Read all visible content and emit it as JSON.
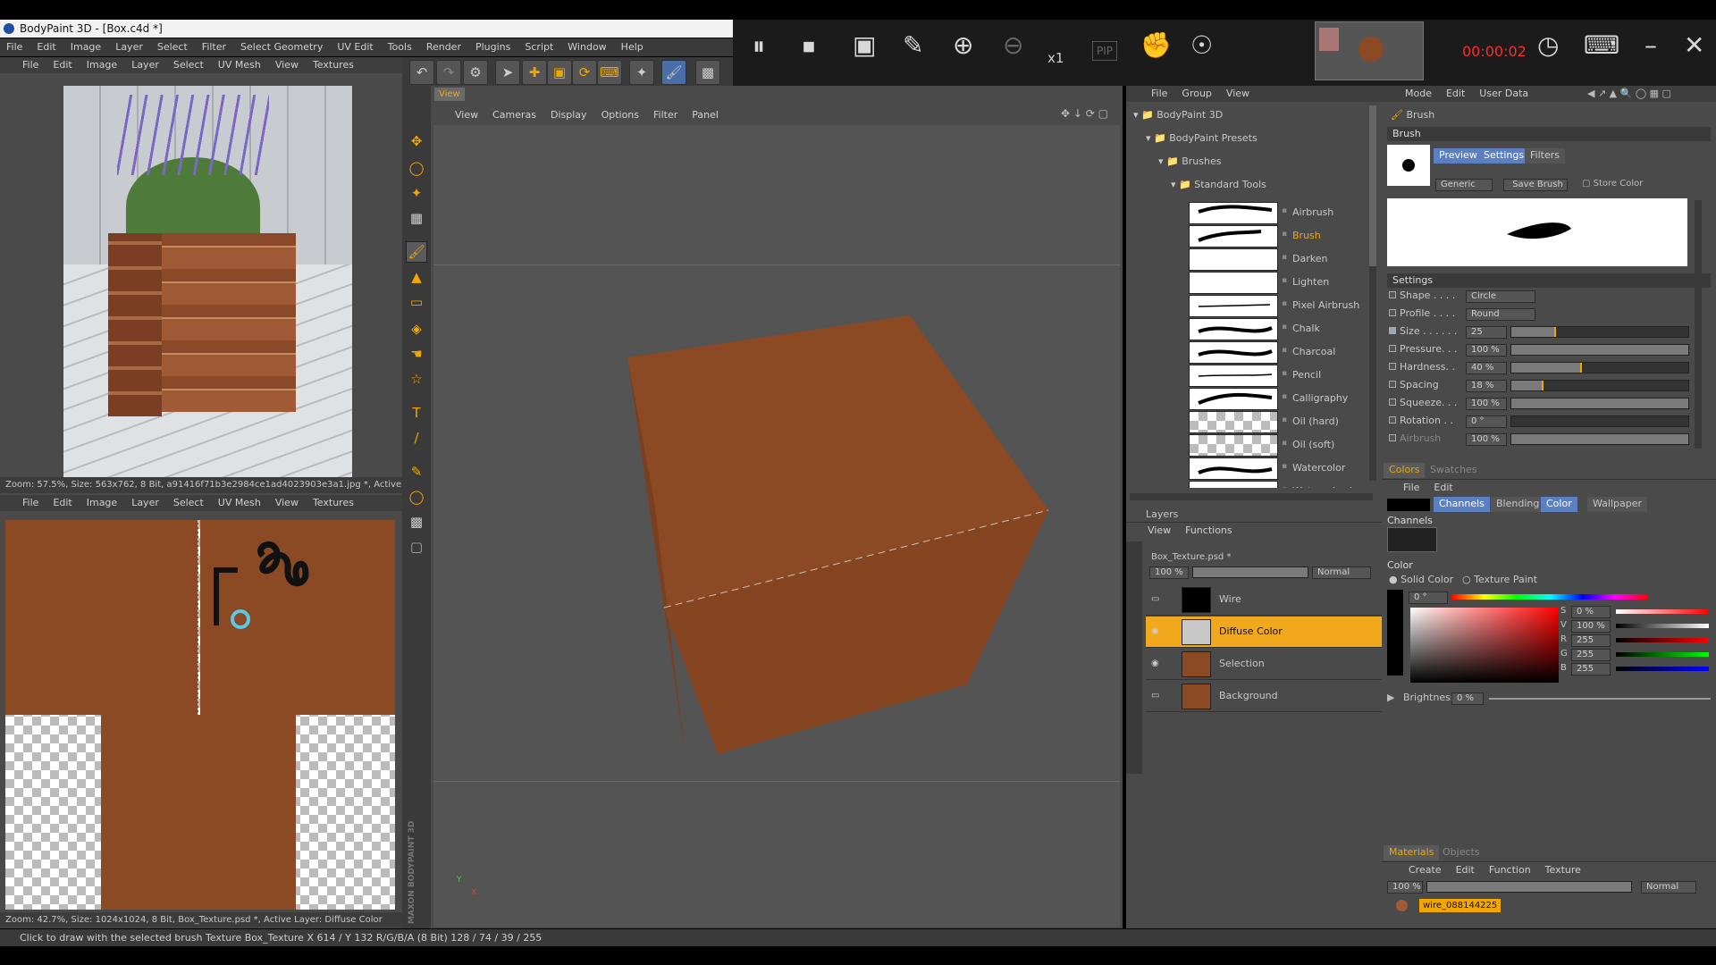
{
  "app": {
    "title": "BodyPaint 3D - [Box.c4d *]"
  },
  "main_menu": [
    "File",
    "Edit",
    "Image",
    "Layer",
    "Select",
    "Filter",
    "Select Geometry",
    "UV Edit",
    "Tools",
    "Render",
    "Plugins",
    "Script",
    "Window",
    "Help"
  ],
  "recorder": {
    "zoom": "x1",
    "pip": "PIP",
    "timer": "00:00:02",
    "window_controls": [
      "minimize-icon",
      "close-icon"
    ]
  },
  "texture_view_top": {
    "menu": [
      "File",
      "Edit",
      "Image",
      "Layer",
      "Select",
      "UV Mesh",
      "View",
      "Textures"
    ],
    "status": "Zoom: 57.5%, Size: 563x762, 8 Bit, a91416f71b3e2984ce1ad4023903e3a1.jpg *, Active La"
  },
  "texture_view_bottom": {
    "menu": [
      "File",
      "Edit",
      "Image",
      "Layer",
      "Select",
      "UV Mesh",
      "View",
      "Textures"
    ],
    "status": "Zoom: 42.7%, Size: 1024x1024, 8 Bit, Box_Texture.psd *, Active Layer: Diffuse Color"
  },
  "viewport": {
    "tab": "View",
    "menu": [
      "View",
      "Cameras",
      "Display",
      "Options",
      "Filter",
      "Panel"
    ],
    "side_label": "MAXON BODYPAINT 3D",
    "colors": {
      "box_face": "#8b4a24",
      "viewport_bg": "#545454"
    }
  },
  "content_browser": {
    "menu": [
      "File",
      "Group",
      "View"
    ],
    "tree": [
      "BodyPaint 3D",
      "BodyPaint Presets",
      "Brushes",
      "Standard Tools"
    ],
    "brushes": [
      "Airbrush",
      "Brush",
      "Darken",
      "Lighten",
      "Pixel Airbrush",
      "Chalk",
      "Charcoal",
      "Pencil",
      "Calligraphy",
      "Oil (hard)",
      "Oil (soft)",
      "Watercolor",
      "Watercolor (rou"
    ],
    "selected_brush": "Brush"
  },
  "layers": {
    "title": "Layers",
    "menu": [
      "View",
      "Functions"
    ],
    "file": "Box_Texture.psd *",
    "opacity": "100 %",
    "mode": "Normal",
    "items": [
      "Wire",
      "Diffuse Color",
      "Selection",
      "Background"
    ],
    "active": "Diffuse Color"
  },
  "attributes": {
    "menu": [
      "Mode",
      "Edit",
      "User Data"
    ],
    "object": "Brush",
    "section": "Brush",
    "tabs": [
      "Preview",
      "Settings",
      "Filters"
    ],
    "preset": "Generic",
    "save_button": "Save Brush",
    "store_color": "Store Color",
    "settings_title": "Settings",
    "settings": [
      {
        "label": "Shape . . . .",
        "value": "Circle",
        "type": "select"
      },
      {
        "label": "Profile . . . .",
        "value": "Round",
        "type": "select"
      },
      {
        "label": "Size . . . . . .",
        "value": "25",
        "level": 0.25
      },
      {
        "label": "Pressure. . .",
        "value": "100 %",
        "level": 1.0
      },
      {
        "label": "Hardness. .",
        "value": "40 %",
        "level": 0.4
      },
      {
        "label": "Spacing",
        "value": "18 %",
        "level": 0.18
      },
      {
        "label": "Squeeze. . .",
        "value": "100 %",
        "level": 1.0
      },
      {
        "label": "Rotation . .",
        "value": "0 °",
        "level": 0.0
      },
      {
        "label": "Airbrush",
        "value": "100 %",
        "level": 1.0
      }
    ]
  },
  "colors": {
    "tabs": [
      "Colors",
      "Swatches"
    ],
    "menu": [
      "File",
      "Edit"
    ],
    "mode_tabs": [
      "Channels",
      "Blending",
      "Color",
      "Wallpaper"
    ],
    "channels_title": "Channels",
    "color_title": "Color",
    "solid_color": "Solid Color",
    "texture_paint": "Texture Paint",
    "hue": "0 °",
    "s": "0 %",
    "v": "100 %",
    "r": "255",
    "g": "255",
    "b": "255",
    "brightness_label": "Brightness",
    "brightness": "0 %"
  },
  "materials": {
    "tabs": [
      "Materials",
      "Objects"
    ],
    "menu": [
      "Create",
      "Edit",
      "Function",
      "Texture"
    ],
    "opacity": "100 %",
    "mode": "Normal",
    "material": "wire_088144225"
  },
  "statusbar": {
    "text": "Click to draw with the selected brush  Texture Box_Texture   X 614 / Y 132 R/G/B/A (8 Bit) 128 / 74 / 39 / 255"
  }
}
